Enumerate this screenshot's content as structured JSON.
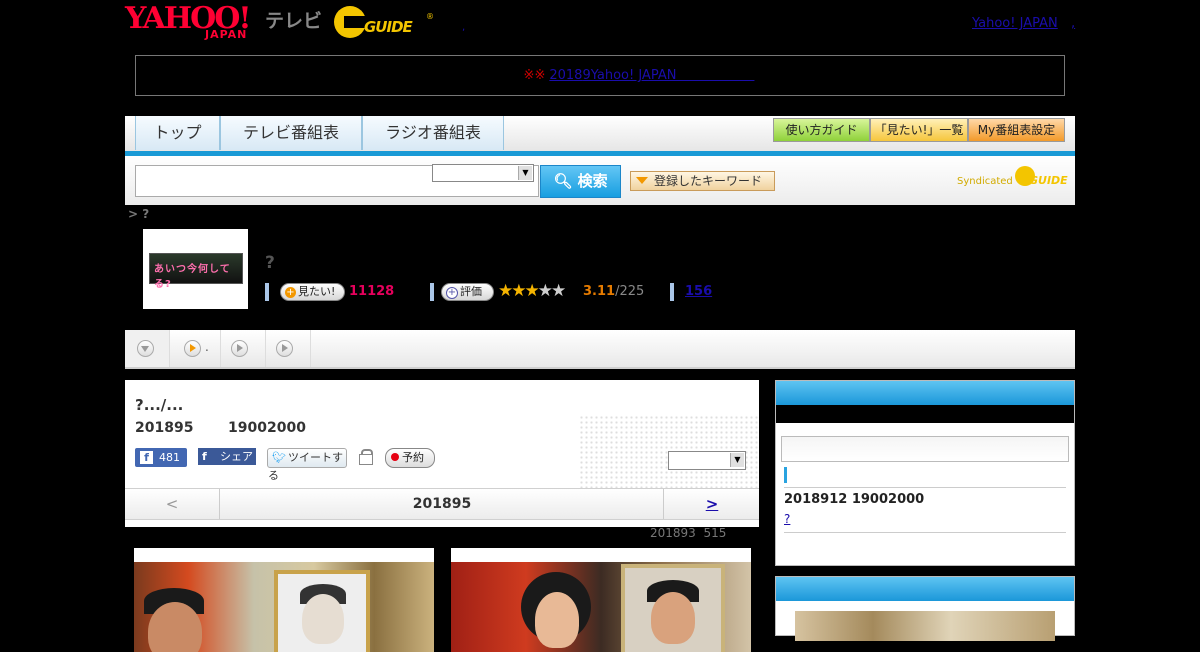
{
  "header": {
    "yahoo_logo_text": "YAHOO!",
    "yahoo_logo_sub": "JAPAN",
    "tv_label": "テレビ",
    "gguide_logo_text": "GUIDE",
    "gguide_reg": "®",
    "dot": ",",
    "yahoo_japan_link": "Yahoo! JAPAN",
    "trailing_link": ","
  },
  "notice": {
    "mark": "※※",
    "link_text": "2018",
    "link_suffix": "9Yahoo! JAPAN　　　　　　"
  },
  "nav": {
    "tabs": [
      "トップ",
      "テレビ番組表",
      "ラジオ番組表"
    ],
    "buttons": [
      "使い方ガイド",
      "「見たい!」一覧",
      "My番組表設定"
    ],
    "accent_color": "#1a9ad6"
  },
  "search": {
    "input_value": "",
    "select_value": "",
    "button_label": "検索",
    "keyword_button": "登録したキーワード",
    "syndicated_label": "Syndicated",
    "syndicated_logo": "GUIDE"
  },
  "breadcrumb": {
    "text": "> ?"
  },
  "program": {
    "thumb_text": "あいつ今何してる?",
    "title": "?",
    "want_label": "見たい!",
    "want_count": "11128",
    "rate_label": "評価",
    "rating_stars": 3,
    "rating_max": 5,
    "rating_value": "3.11",
    "rating_denominator": "/225",
    "review_count": "156"
  },
  "tabstrip": {
    "tab2_label": ".",
    "icons": [
      "chevron-down-icon",
      "play-icon",
      "play-icon",
      "play-icon"
    ]
  },
  "episode": {
    "title": "?.../...",
    "date": "201895",
    "time": "19002000",
    "fb_like_count": "481",
    "fb_share_label": "シェア",
    "tweet_label": "ツイートする",
    "reserve_label": "予約",
    "select_value": "",
    "pager_prev": "<",
    "pager_current": "201895",
    "pager_next": ">",
    "meta_date": "201893",
    "meta_time": "515"
  },
  "sidebar": {
    "input_value": "",
    "date": "2018912  19002000",
    "link": "? "
  }
}
